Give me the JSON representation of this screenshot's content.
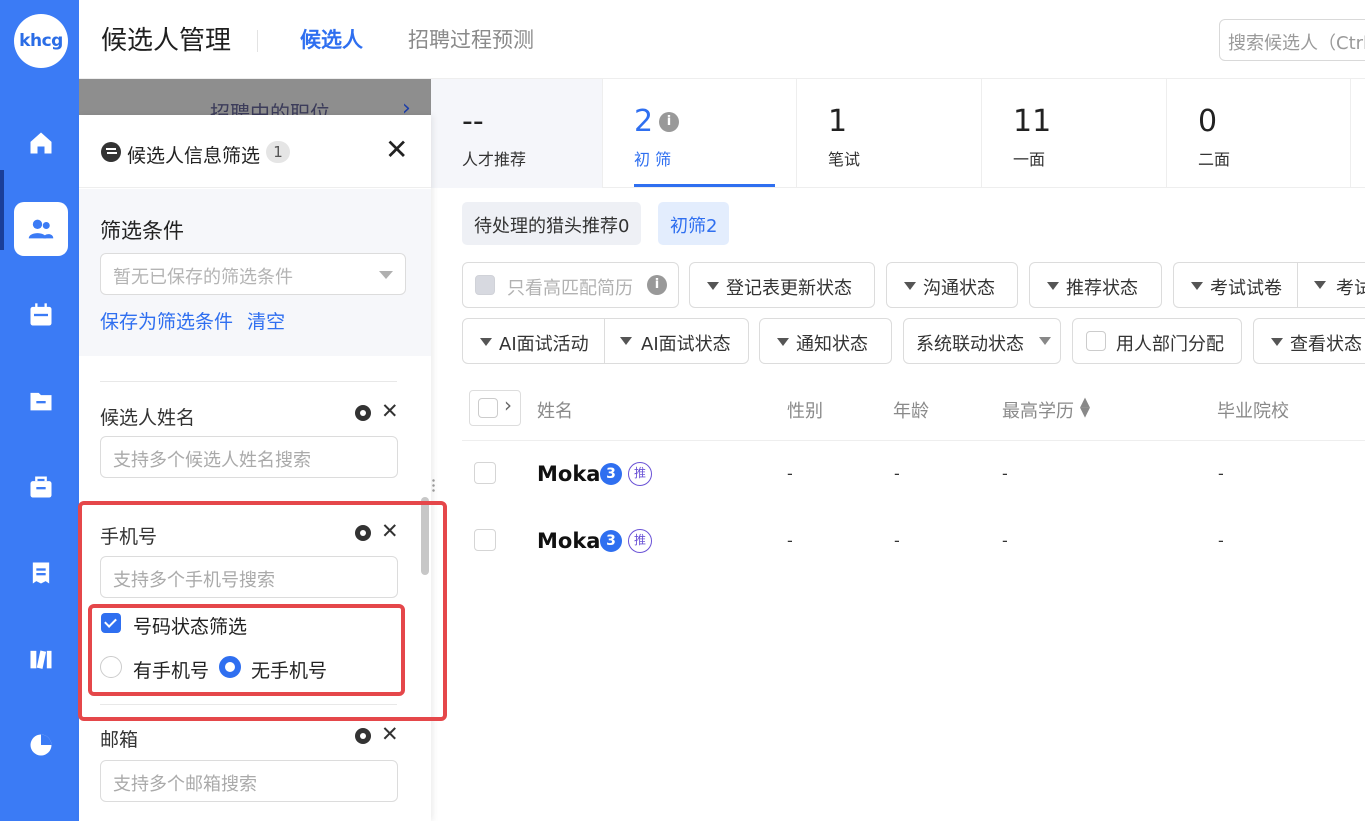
{
  "logo": "khcg",
  "header": {
    "title": "候选人管理",
    "tabs": [
      "候选人",
      "招聘过程预测"
    ],
    "search_placeholder": "搜索候选人（Ctrl"
  },
  "job_bar": {
    "label": "招聘中的职位"
  },
  "filter_panel": {
    "title": "候选人信息筛选",
    "badge": "1",
    "conditions_title": "筛选条件",
    "saved_placeholder": "暂无已保存的筛选条件",
    "save_link": "保存为筛选条件",
    "clear_link": "清空",
    "fields": [
      {
        "label": "候选人姓名",
        "placeholder": "支持多个候选人姓名搜索"
      },
      {
        "label": "手机号",
        "placeholder": "支持多个手机号搜索"
      },
      {
        "label": "邮箱",
        "placeholder": "支持多个邮箱搜索"
      }
    ],
    "phone_status_label": "号码状态筛选",
    "radio_has": "有手机号",
    "radio_none": "无手机号"
  },
  "stages": [
    {
      "count": "--",
      "label": "人才推荐"
    },
    {
      "count": "2",
      "label": "初 筛"
    },
    {
      "count": "1",
      "label": "笔试"
    },
    {
      "count": "11",
      "label": "一面"
    },
    {
      "count": "0",
      "label": "二面"
    }
  ],
  "subtabs": [
    "待处理的猎头推荐0",
    "初筛2"
  ],
  "filters_row1": [
    "只看高匹配简历",
    "登记表更新状态",
    "沟通状态",
    "推荐状态",
    "考试试卷",
    "考试"
  ],
  "filters_row2": [
    "AI面试活动",
    "AI面试状态",
    "通知状态",
    "系统联动状态",
    "用人部门分配",
    "查看状态"
  ],
  "table": {
    "headers": [
      "姓名",
      "性别",
      "年龄",
      "最高学历",
      "毕业院校"
    ],
    "rows": [
      {
        "name": "Moka",
        "count": "3",
        "tag": "推",
        "gender": "-",
        "age": "-",
        "edu": "-",
        "school": "-"
      },
      {
        "name": "Moka",
        "count": "3",
        "tag": "推",
        "gender": "-",
        "age": "-",
        "edu": "-",
        "school": "-"
      }
    ]
  },
  "colors": {
    "primary": "#2f6ff0",
    "rail": "#3b7bf5",
    "highlight": "#e5474a"
  }
}
